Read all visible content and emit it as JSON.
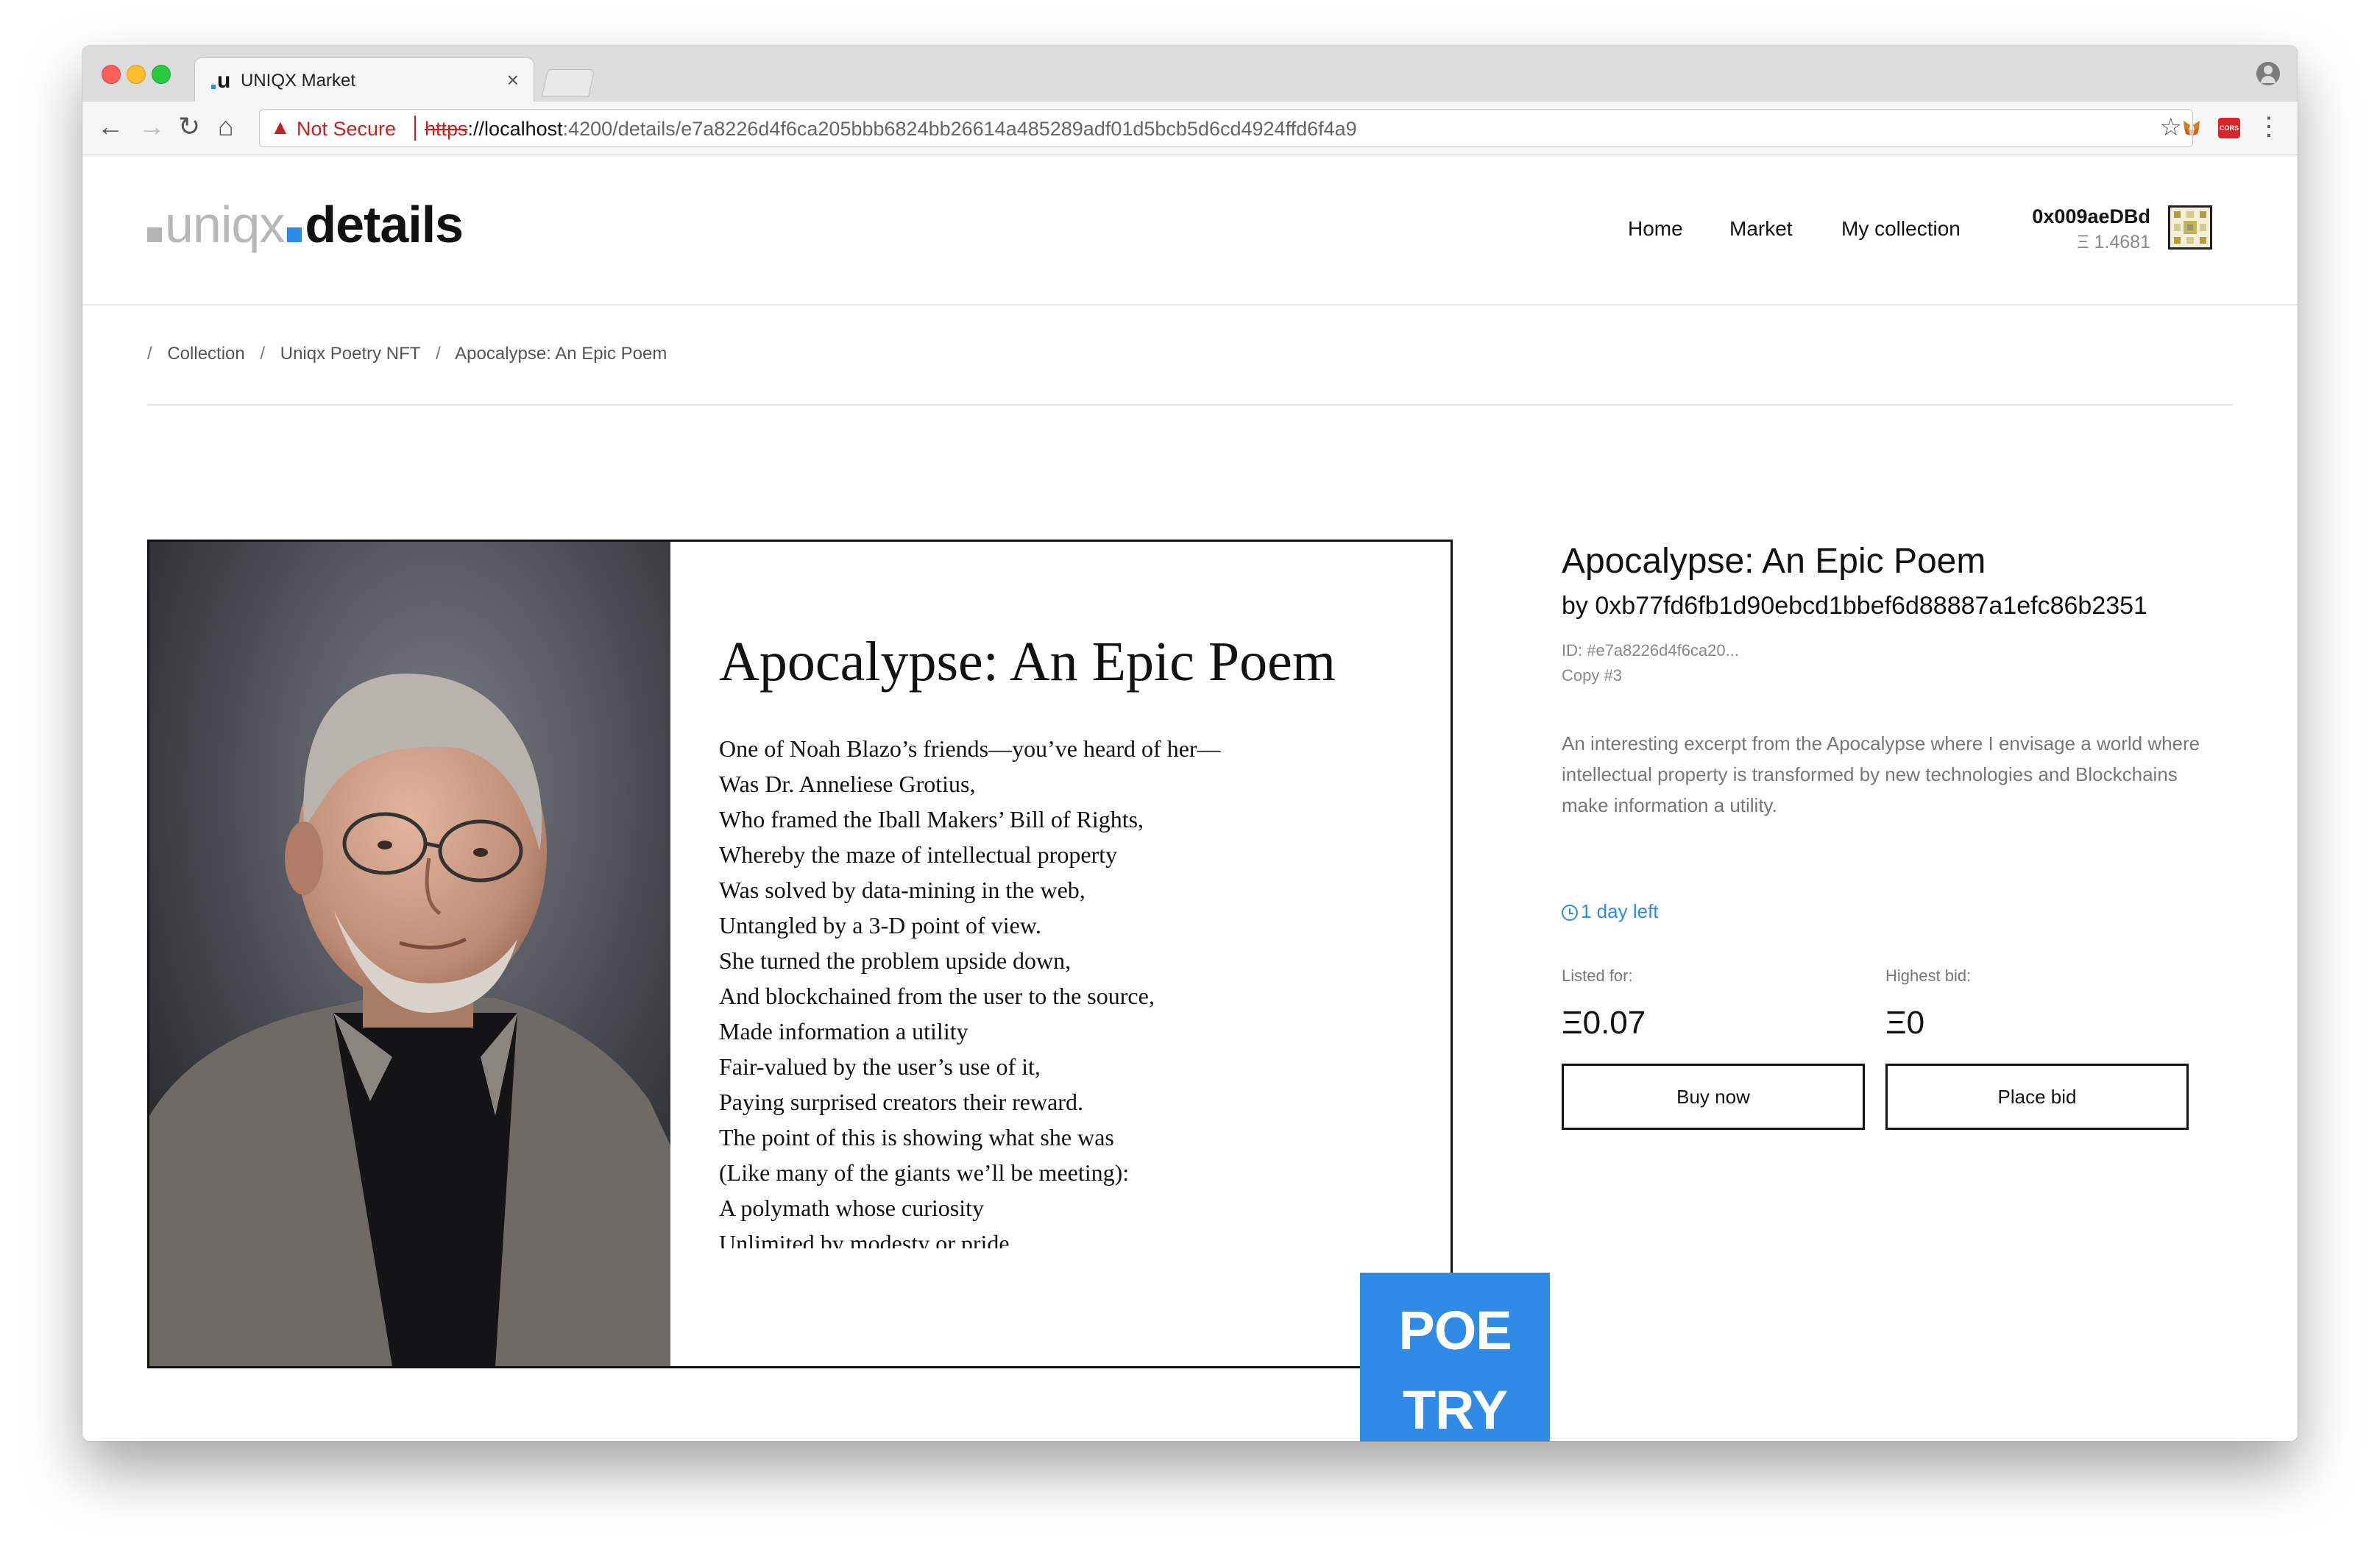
{
  "browser": {
    "tab_title": "UNIQX Market",
    "tab_favicon": "u",
    "not_secure": "Not Secure",
    "url_scheme": "https",
    "url_host": "://localhost",
    "url_path": ":4200/details/e7a8226d4f6ca205bbb6824bb26614a485289adf01d5bcb5d6cd4924ffd6f4a9",
    "extension_badge": "CORS"
  },
  "header": {
    "logo_left": "uniqx",
    "logo_right": "details",
    "nav": [
      "Home",
      "Market",
      "My collection"
    ],
    "wallet_address": "0x009aeDBd",
    "wallet_balance": "Ξ 1.4681"
  },
  "breadcrumb": [
    "Collection",
    "Uniqx Poetry NFT",
    "Apocalypse: An Epic Poem"
  ],
  "artwork": {
    "poem_title": "Apocalypse: An Epic Poem",
    "lines": [
      "One of Noah Blazo’s friends—you’ve heard of her—",
      "Was Dr. Anneliese Grotius,",
      "Who framed the Iball Makers’ Bill of Rights,",
      "Whereby the maze of intellectual property",
      "Was solved by data-mining in the web,",
      "Untangled by a 3-D point of view.",
      "She turned the problem upside down,",
      "And blockchained from the user to the source,",
      "Made information a utility",
      "Fair-valued by the user’s use of it,",
      "Paying surprised creators their reward.",
      "The point of this is showing what she was",
      "(Like many of the giants we’ll be meeting):",
      "A polymath whose curiosity",
      "Unlimited by modesty or pride"
    ],
    "badge_line1": "POE",
    "badge_line2": "TRY"
  },
  "details": {
    "title": "Apocalypse: An Epic Poem",
    "by": "by 0xb77fd6fb1d90ebcd1bbef6d88887a1efc86b2351",
    "id": "ID: #e7a8226d4f6ca20...",
    "copy": "Copy #3",
    "description": "An interesting excerpt from the Apocalypse where I envisage a world where intellectual property is transformed by new technologies and Blockchains make information a utility.",
    "time_left": "1 day left",
    "listed_label": "Listed for:",
    "listed_value": "Ξ0.07",
    "bid_label": "Highest bid:",
    "bid_value": "Ξ0",
    "buy_label": "Buy now",
    "bid_button_label": "Place bid"
  },
  "colors": {
    "accent": "#2f8be6",
    "insecure": "#c5221f"
  }
}
